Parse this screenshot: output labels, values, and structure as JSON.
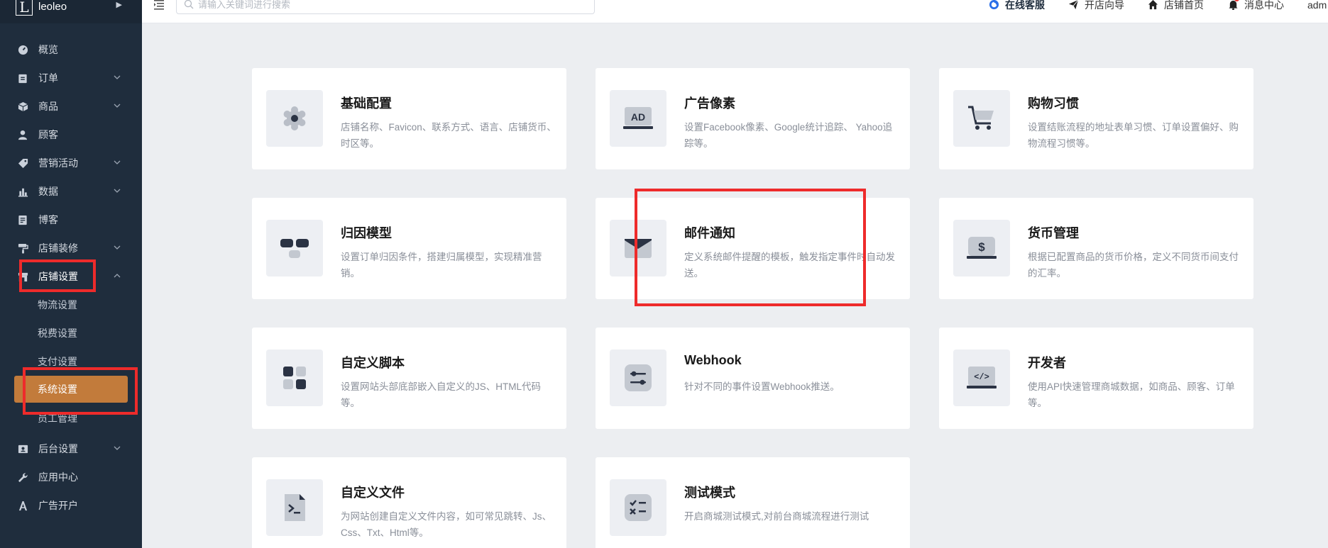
{
  "brand": {
    "logo_letter": "L",
    "name": "leoleo"
  },
  "sidebar": {
    "items": [
      {
        "label": "概览",
        "icon": "gauge-icon",
        "has_children": false
      },
      {
        "label": "订单",
        "icon": "clipboard-icon",
        "has_children": true
      },
      {
        "label": "商品",
        "icon": "box-icon",
        "has_children": true
      },
      {
        "label": "顾客",
        "icon": "user-icon",
        "has_children": false
      },
      {
        "label": "营销活动",
        "icon": "tag-icon",
        "has_children": true
      },
      {
        "label": "数据",
        "icon": "bar-chart-icon",
        "has_children": true
      },
      {
        "label": "博客",
        "icon": "document-icon",
        "has_children": false
      },
      {
        "label": "店铺装修",
        "icon": "paint-roller-icon",
        "has_children": true
      },
      {
        "label": "店铺设置",
        "icon": "store-icon",
        "has_children": true,
        "expanded": true
      },
      {
        "label": "后台设置",
        "icon": "id-card-icon",
        "has_children": true
      },
      {
        "label": "应用中心",
        "icon": "wrench-icon",
        "has_children": false
      },
      {
        "label": "广告开户",
        "icon": "ad-icon",
        "has_children": false
      }
    ],
    "sub_items": [
      {
        "label": "物流设置"
      },
      {
        "label": "税费设置"
      },
      {
        "label": "支付设置"
      },
      {
        "label": "系统设置",
        "active": true
      },
      {
        "label": "员工管理"
      }
    ]
  },
  "header": {
    "search_placeholder": "请输入关键词进行搜索",
    "links": [
      {
        "label": "在线客服",
        "icon": "chat-bubble-icon"
      },
      {
        "label": "开店向导",
        "icon": "paper-plane-icon"
      },
      {
        "label": "店铺首页",
        "icon": "home-icon"
      },
      {
        "label": "消息中心",
        "icon": "bell-icon"
      }
    ],
    "user": "adm"
  },
  "cards": [
    {
      "title": "基础配置",
      "desc": "店铺名称、Favicon、联系方式、语言、店铺货币、时区等。",
      "icon": "gear-icon"
    },
    {
      "title": "广告像素",
      "desc": "设置Facebook像素、Google统计追踪、 Yahoo追踪等。",
      "icon": "ad-monitor-icon",
      "icon_text": "AD"
    },
    {
      "title": "购物习惯",
      "desc": "设置结账流程的地址表单习惯、订单设置偏好、购物流程习惯等。",
      "icon": "shopping-cart-icon"
    },
    {
      "title": "归因模型",
      "desc": "设置订单归因条件，搭建归属模型，实现精准营销。",
      "icon": "attribution-model-icon"
    },
    {
      "title": "邮件通知",
      "desc": "定义系统邮件提醒的模板，触发指定事件时自动发送。",
      "icon": "envelope-icon"
    },
    {
      "title": "货币管理",
      "desc": "根据已配置商品的货币价格，定义不同货币间支付的汇率。",
      "icon": "currency-icon",
      "icon_text": "$"
    },
    {
      "title": "自定义脚本",
      "desc": "设置网站头部底部嵌入自定义的JS、HTML代码等。",
      "icon": "blocks-icon"
    },
    {
      "title": "Webhook",
      "desc": "针对不同的事件设置Webhook推送。",
      "icon": "sliders-icon"
    },
    {
      "title": "开发者",
      "desc": "使用API快速管理商城数据，如商品、顾客、订单等。",
      "icon": "code-icon",
      "icon_text": "</>"
    },
    {
      "title": "自定义文件",
      "desc": "为网站创建自定义文件内容，如可常见跳转、Js、Css、Txt、Html等。",
      "icon": "terminal-file-icon"
    },
    {
      "title": "测试模式",
      "desc": "开启商城测试模式,对前台商城流程进行测试",
      "icon": "checklist-icon"
    }
  ],
  "colors": {
    "sidebar_bg": "#1f2d3d",
    "active_item": "#c27b3b",
    "highlight": "#ee2b2b",
    "page_bg": "#eceef1"
  }
}
